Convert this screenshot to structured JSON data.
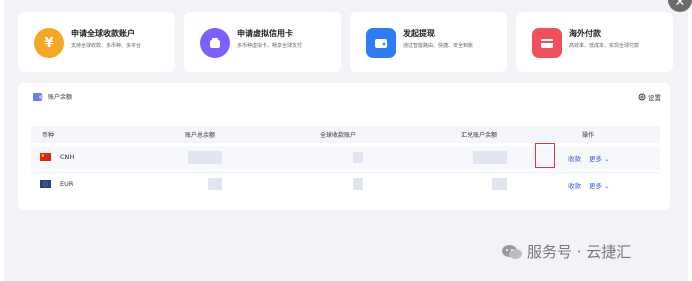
{
  "cards": [
    {
      "title": "申请全球收款账户",
      "desc": "支持全球收款、多币种、多平台",
      "icon": "coin-icon",
      "color": "#f5a623"
    },
    {
      "title": "申请虚拟信用卡",
      "desc": "多币种虚拟卡，畅享全球支付",
      "icon": "card-icon",
      "color": "#7b61ff"
    },
    {
      "title": "发起提现",
      "desc": "通过智能路由、快捷、安全到账",
      "icon": "wallet-icon",
      "color": "#2d7df6"
    },
    {
      "title": "海外付款",
      "desc": "高效率、低成本、实现全球付款",
      "icon": "bank-card-icon",
      "color": "#f0505a"
    }
  ],
  "panel": {
    "title": "账户余额",
    "settings": "设置",
    "columns": [
      "币种",
      "账户总余额",
      "全球收款账户",
      "汇兑账户余额",
      "操作"
    ],
    "rows": [
      {
        "currency": "CNH",
        "flag": "cn-flag-icon",
        "action": "收款",
        "more": "更多"
      },
      {
        "currency": "EUR",
        "flag": "eu-flag-icon",
        "action": "收款",
        "more": "更多"
      }
    ]
  },
  "watermark": "服务号 · 云捷汇"
}
